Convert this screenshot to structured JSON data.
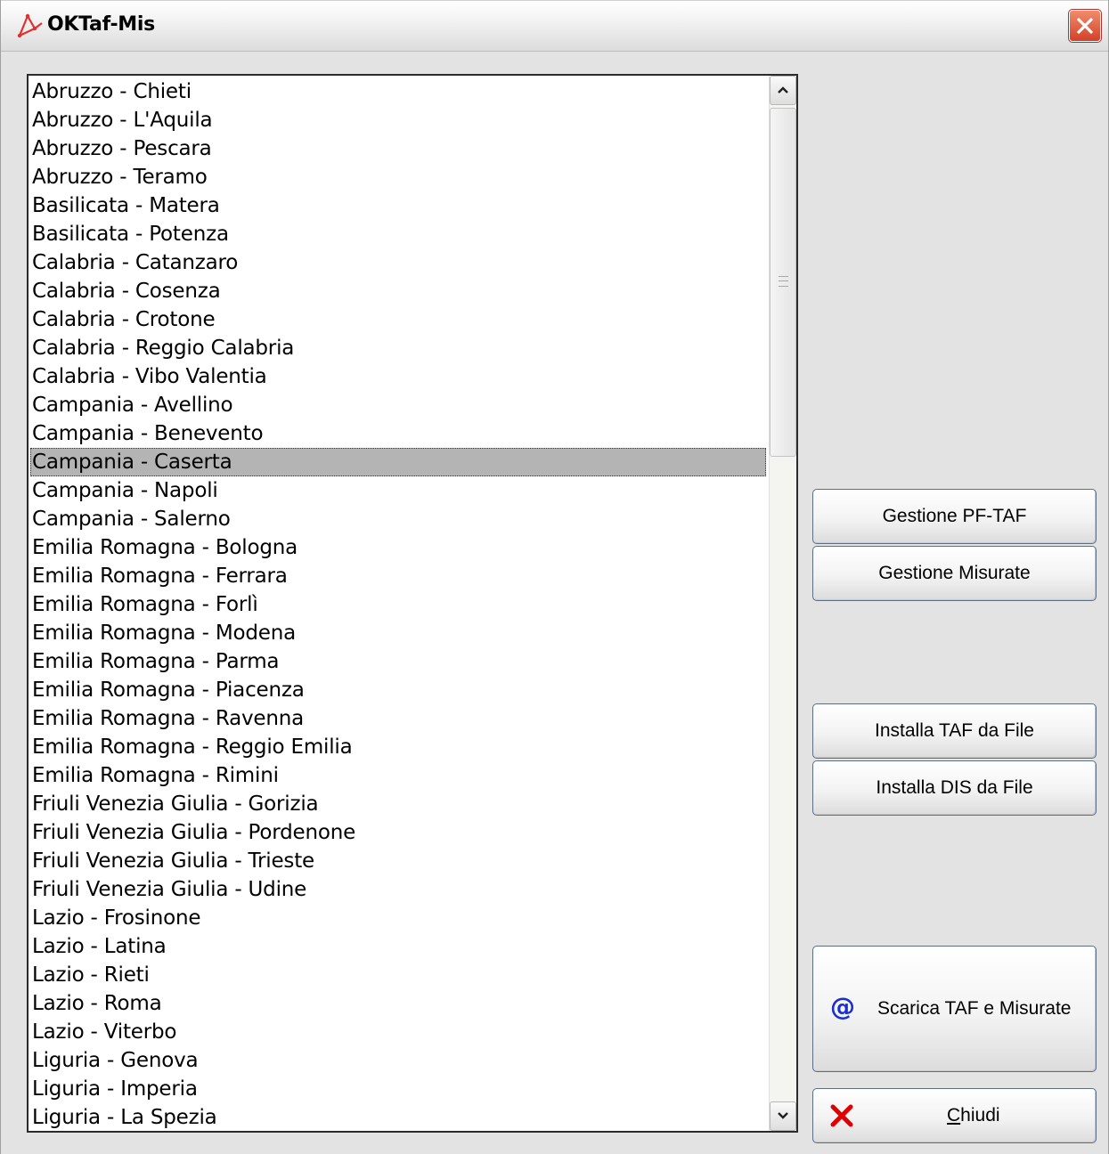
{
  "window": {
    "title": "OKTaf-Mis"
  },
  "list": {
    "selected_index": 13,
    "items": [
      "Abruzzo - Chieti",
      "Abruzzo - L'Aquila",
      "Abruzzo - Pescara",
      "Abruzzo - Teramo",
      "Basilicata - Matera",
      "Basilicata - Potenza",
      "Calabria - Catanzaro",
      "Calabria - Cosenza",
      "Calabria - Crotone",
      "Calabria - Reggio Calabria",
      "Calabria - Vibo Valentia",
      "Campania - Avellino",
      "Campania - Benevento",
      "Campania - Caserta",
      "Campania - Napoli",
      "Campania - Salerno",
      "Emilia Romagna - Bologna",
      "Emilia Romagna - Ferrara",
      "Emilia Romagna - Forlì",
      "Emilia Romagna - Modena",
      "Emilia Romagna - Parma",
      "Emilia Romagna - Piacenza",
      "Emilia Romagna - Ravenna",
      "Emilia Romagna - Reggio Emilia",
      "Emilia Romagna - Rimini",
      "Friuli Venezia Giulia - Gorizia",
      "Friuli Venezia Giulia - Pordenone",
      "Friuli Venezia Giulia - Trieste",
      "Friuli Venezia Giulia - Udine",
      "Lazio - Frosinone",
      "Lazio - Latina",
      "Lazio - Rieti",
      "Lazio - Roma",
      "Lazio - Viterbo",
      "Liguria - Genova",
      "Liguria - Imperia",
      "Liguria - La Spezia"
    ]
  },
  "buttons": {
    "gestione_pf_taf": "Gestione PF-TAF",
    "gestione_misurate": "Gestione Misurate",
    "installa_taf": "Installa TAF da File",
    "installa_dis": "Installa DIS da File",
    "scarica": {
      "label": "Scarica TAF e Misurate",
      "icon": "@"
    },
    "chiudi": {
      "accel": "C",
      "rest": "hiudi"
    }
  },
  "colors": {
    "selection": "#b4b4b4",
    "close_button": "#d4402a",
    "chiudi_icon": "#e00000",
    "at_icon": "#1a2fd0"
  }
}
